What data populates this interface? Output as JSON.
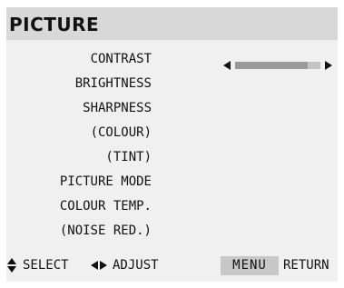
{
  "title": "PICTURE",
  "items": [
    {
      "label": "CONTRAST"
    },
    {
      "label": "BRIGHTNESS"
    },
    {
      "label": "SHARPNESS"
    },
    {
      "label": "(COLOUR)"
    },
    {
      "label": "(TINT)"
    },
    {
      "label": "PICTURE MODE"
    },
    {
      "label": "COLOUR TEMP."
    },
    {
      "label": "(NOISE RED.)"
    }
  ],
  "contrast_slider": {
    "left_icon": "arrow-left-icon",
    "right_icon": "arrow-right-icon",
    "level_fraction": 0.85
  },
  "footer": {
    "select_icon": "up-down-arrows-icon",
    "select_label": "SELECT",
    "adjust_icon": "left-right-arrows-icon",
    "adjust_label": "ADJUST",
    "menu_key": "MENU",
    "return_label": "RETURN"
  },
  "colors": {
    "title_bar": "#d8d8d8",
    "panel": "#f0f0f0",
    "slider_track": "#c4c4c4",
    "slider_fill": "#9a9a9a",
    "menu_key_bg": "#c8c8c8"
  }
}
